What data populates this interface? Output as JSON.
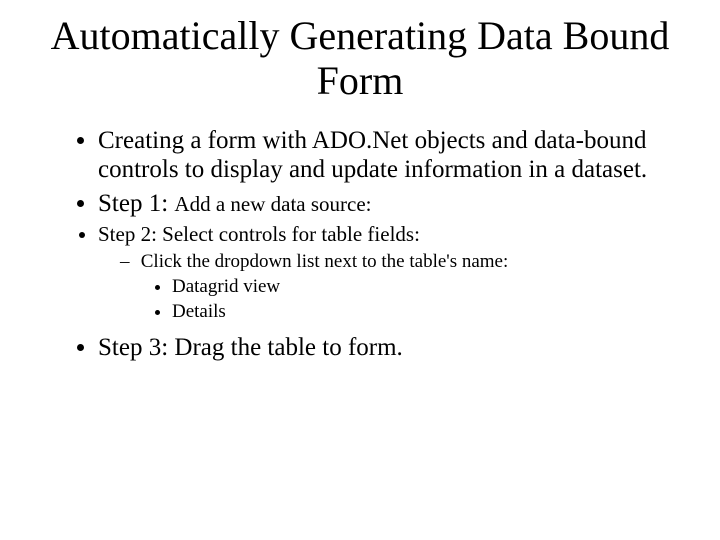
{
  "title": "Automatically Generating Data Bound Form",
  "bullets": {
    "intro": "Creating a form with ADO.Net objects and data-bound controls to display and update information in a dataset.",
    "step1_label": "Step 1: ",
    "step1_text": "Add a new data source:",
    "step2": "Step 2: Select controls for table fields:",
    "step2_sub": "Click the dropdown list next to the table's name:",
    "step2_sub_items": {
      "a": "Datagrid view",
      "b": "Details"
    },
    "step3": "Step 3: Drag the table to form."
  }
}
